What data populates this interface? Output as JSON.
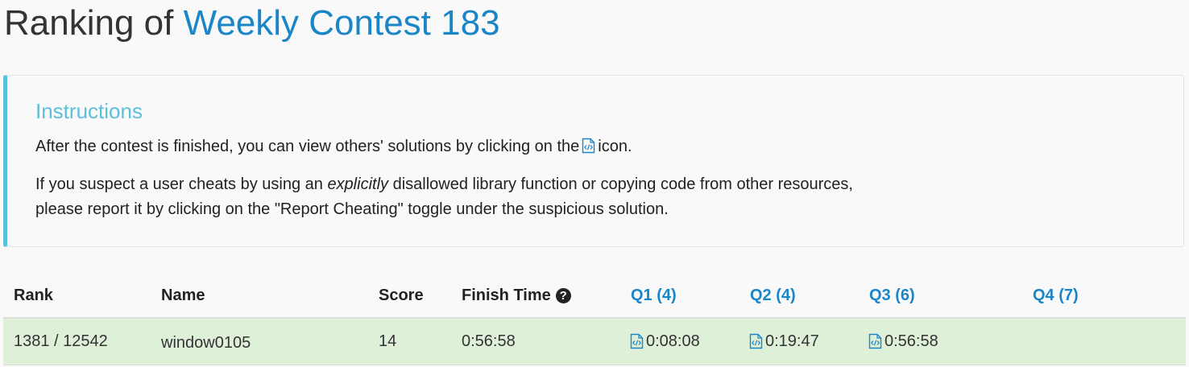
{
  "page": {
    "title_prefix": "Ranking of",
    "contest_name": "Weekly Contest 183"
  },
  "instructions": {
    "heading": "Instructions",
    "p1_before_icon": "After the contest is finished, you can view others' solutions by clicking on the",
    "p1_after_icon": "icon.",
    "p2_line1_before": "If you suspect a user cheats by using an",
    "p2_line1_emphasis": "explicitly",
    "p2_line1_after": "disallowed library function or copying code from other resources,",
    "p2_line2": "please report it by clicking on the \"Report Cheating\" toggle under the suspicious solution."
  },
  "table": {
    "headers": {
      "rank": "Rank",
      "name": "Name",
      "score": "Score",
      "finish_time": "Finish Time",
      "finish_time_help_icon": "question-circle-icon",
      "q1": "Q1 (4)",
      "q2": "Q2 (4)",
      "q3": "Q3 (6)",
      "q4": "Q4 (7)"
    },
    "rows": [
      {
        "rank": "1381 / 12542",
        "name": "window0105",
        "score": "14",
        "finish_time": "0:56:58",
        "q1": "0:08:08",
        "q2": "0:19:47",
        "q3": "0:56:58",
        "q4": ""
      }
    ],
    "row_highlight_color": "#dff0d8"
  },
  "colors": {
    "link": "#1a86c8",
    "instructions_accent": "#5bc0de"
  }
}
